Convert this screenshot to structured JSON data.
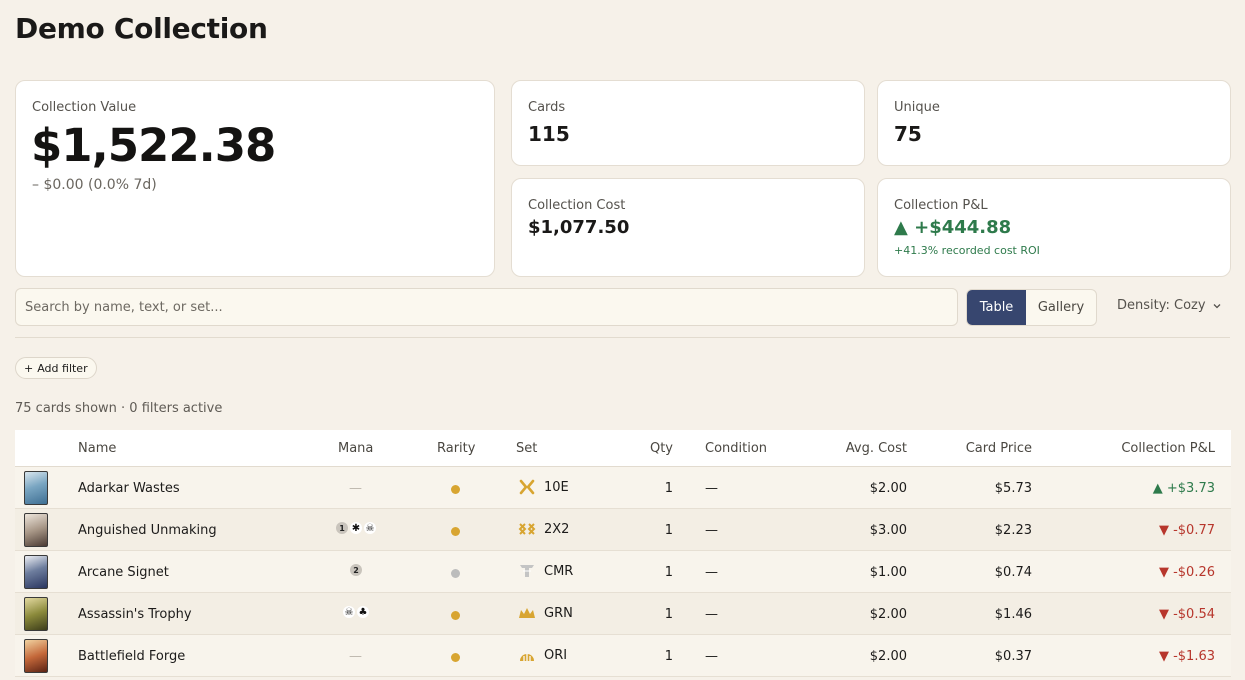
{
  "page": {
    "title": "Demo Collection"
  },
  "stats": {
    "collection_value": {
      "label": "Collection Value",
      "value": "$1,522.38",
      "change": "– $0.00 (0.0% 7d)"
    },
    "cards": {
      "label": "Cards",
      "value": "115"
    },
    "unique": {
      "label": "Unique",
      "value": "75"
    },
    "collection_cost": {
      "label": "Collection Cost",
      "value": "$1,077.50"
    },
    "collection_pnl": {
      "label": "Collection P&L",
      "value": "▲ +$444.88",
      "sub": "+41.3% recorded cost ROI"
    }
  },
  "toolbar": {
    "search_placeholder": "Search by name, text, or set...",
    "view_table": "Table",
    "view_gallery": "Gallery",
    "density": "Density: Cozy",
    "add_filter": "Add filter"
  },
  "summary": "75 cards shown · 0 filters active",
  "table": {
    "headers": [
      "Name",
      "Mana",
      "Rarity",
      "Set",
      "Qty",
      "Condition",
      "Avg. Cost",
      "Card Price",
      "Collection P&L"
    ],
    "rows": [
      {
        "name": "Adarkar Wastes",
        "mana": "—",
        "rarity": "rare",
        "set": "10E",
        "qty": "1",
        "condition": "—",
        "avg_cost": "$2.00",
        "price": "$5.73",
        "pnl": "▲ +$3.73",
        "pnl_dir": "up"
      },
      {
        "name": "Anguished Unmaking",
        "mana": [
          "1",
          "W",
          "B"
        ],
        "rarity": "rare",
        "set": "2X2",
        "qty": "1",
        "condition": "—",
        "avg_cost": "$3.00",
        "price": "$2.23",
        "pnl": "▼ -$0.77",
        "pnl_dir": "down"
      },
      {
        "name": "Arcane Signet",
        "mana": [
          "2"
        ],
        "rarity": "common",
        "set": "CMR",
        "qty": "1",
        "condition": "—",
        "avg_cost": "$1.00",
        "price": "$0.74",
        "pnl": "▼ -$0.26",
        "pnl_dir": "down"
      },
      {
        "name": "Assassin's Trophy",
        "mana": [
          "B",
          "G"
        ],
        "rarity": "rare",
        "set": "GRN",
        "qty": "1",
        "condition": "—",
        "avg_cost": "$2.00",
        "price": "$1.46",
        "pnl": "▼ -$0.54",
        "pnl_dir": "down"
      },
      {
        "name": "Battlefield Forge",
        "mana": "—",
        "rarity": "rare",
        "set": "ORI",
        "qty": "1",
        "condition": "—",
        "avg_cost": "$2.00",
        "price": "$0.37",
        "pnl": "▼ -$1.63",
        "pnl_dir": "down"
      }
    ]
  },
  "colors": {
    "background": "#f6f1e9",
    "accent": "#37466f",
    "positive": "#2e7a4b",
    "negative": "#b7362c",
    "rarity_rare": "#d8a531",
    "rarity_common": "#bcbcbc"
  }
}
